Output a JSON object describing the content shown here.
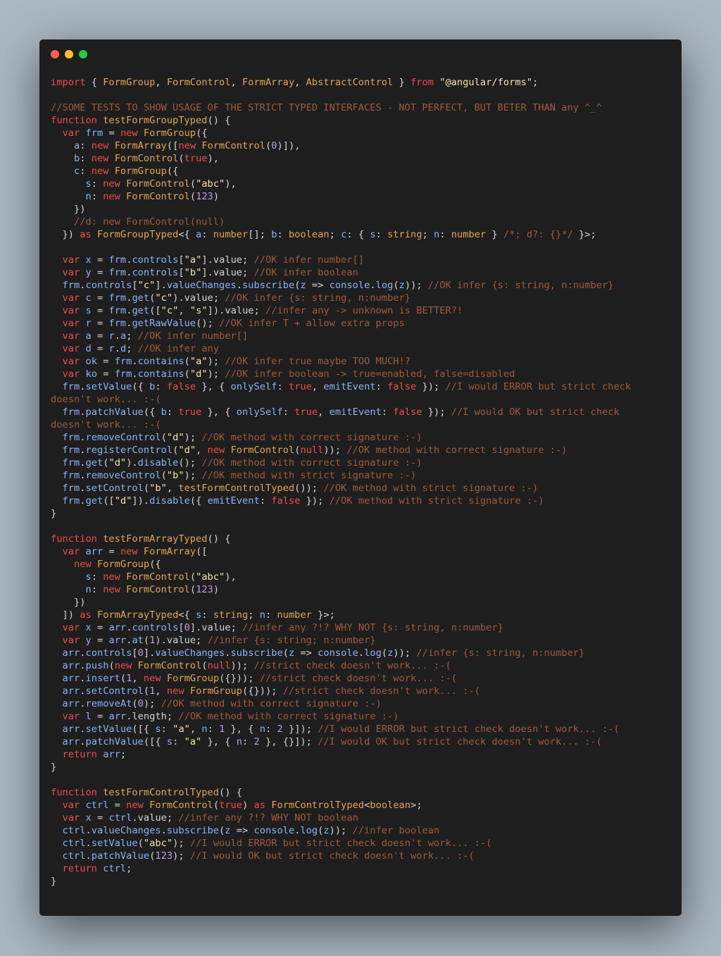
{
  "window": {
    "controls": [
      {
        "name": "close",
        "color": "#ff5f56"
      },
      {
        "name": "minimize",
        "color": "#ffbd2e"
      },
      {
        "name": "maximize",
        "color": "#27c93f"
      }
    ]
  },
  "colors": {
    "background": "#abb8c3",
    "editor": "#1e1e1e",
    "keyword": "#f14c4c",
    "type": "#e5a558",
    "identifier": "#8ab4f8",
    "string": "#f5e6a8",
    "number": "#c29de0",
    "comment": "#a05a3c",
    "plain": "#d4d4d4"
  },
  "code_lines": [
    "import { FormGroup, FormControl, FormArray, AbstractControl } from \"@angular/forms\";",
    "",
    "//SOME TESTS TO SHOW USAGE OF THE STRICT TYPED INTERFACES - NOT PERFECT, BUT BETER THAN any ^_^",
    "function testFormGroupTyped() {",
    "  var frm = new FormGroup({",
    "    a: new FormArray([new FormControl(0)]),",
    "    b: new FormControl(true),",
    "    c: new FormGroup({",
    "      s: new FormControl(\"abc\"),",
    "      n: new FormControl(123)",
    "    })",
    "    //d: new FormControl(null)",
    "  }) as FormGroupTyped<{ a: number[]; b: boolean; c: { s: string; n: number } /*; d?: {}*/ }>;",
    "",
    "  var x = frm.controls[\"a\"].value; //OK infer number[]",
    "  var y = frm.controls[\"b\"].value; //OK infer boolean",
    "  frm.controls[\"c\"].valueChanges.subscribe(z => console.log(z)); //OK infer {s: string, n:number}",
    "  var c = frm.get(\"c\").value; //OK infer {s: string, n:number}",
    "  var s = frm.get([\"c\", \"s\"]).value; //infer any -> unknown is BETTER?!",
    "  var r = frm.getRawValue(); //OK infer T + allow extra props",
    "  var a = r.a; //OK infer number[]",
    "  var d = r.d; //OK infer any",
    "  var ok = frm.contains(\"a\"); //OK infer true maybe TOO MUCH!?",
    "  var ko = frm.contains(\"d\"); //OK infer boolean -> true=enabled, false=disabled",
    "  frm.setValue({ b: false }, { onlySelf: true, emitEvent: false }); //I would ERROR but strict check",
    "doesn't work... :-(",
    "  frm.patchValue({ b: true }, { onlySelf: true, emitEvent: false }); //I would OK but strict check",
    "doesn't work... :-(",
    "  frm.removeControl(\"d\"); //OK method with correct signature :-)",
    "  frm.registerControl(\"d\", new FormControl(null)); //OK method with correct signature :-)",
    "  frm.get(\"d\").disable(); //OK method with correct signature :-)",
    "  frm.removeControl(\"b\"); //OK method with strict signature :-)",
    "  frm.setControl(\"b\", testFormControlTyped()); //OK method with strict signature :-)",
    "  frm.get([\"d\"]).disable({ emitEvent: false }); //OK method with strict signature :-)",
    "}",
    "",
    "function testFormArrayTyped() {",
    "  var arr = new FormArray([",
    "    new FormGroup({",
    "      s: new FormControl(\"abc\"),",
    "      n: new FormControl(123)",
    "    })",
    "  ]) as FormArrayTyped<{ s: string; n: number }>;",
    "  var x = arr.controls[0].value; //infer any ?!? WHY NOT {s: string, n:number}",
    "  var y = arr.at(1).value; //infer {s: string; n:number}",
    "  arr.controls[0].valueChanges.subscribe(z => console.log(z)); //infer {s: string, n:number}",
    "  arr.push(new FormControl(null)); //strict check doesn't work... :-(",
    "  arr.insert(1, new FormGroup({})); //strict check doesn't work... :-(",
    "  arr.setControl(1, new FormGroup({})); //strict check doesn't work... :-(",
    "  arr.removeAt(0); //OK method with correct signature :-)",
    "  var l = arr.length; //OK method with correct signature :-)",
    "  arr.setValue([{ s: \"a\", n: 1 }, { n: 2 }]); //I would ERROR but strict check doesn't work... :-(",
    "  arr.patchValue([{ s: \"a\" }, { n: 2 }, {}]); //I would OK but strict check doesn't work... :-(",
    "  return arr;",
    "}",
    "",
    "function testFormControlTyped() {",
    "  var ctrl = new FormControl(true) as FormControlTyped<boolean>;",
    "  var x = ctrl.value; //infer any ?!? WHY NOT boolean",
    "  ctrl.valueChanges.subscribe(z => console.log(z)); //infer boolean",
    "  ctrl.setValue(\"abc\"); //I would ERROR but strict check doesn't work... :-(",
    "  ctrl.patchValue(123); //I would OK but strict check doesn't work... :-(",
    "  return ctrl;",
    "}"
  ]
}
